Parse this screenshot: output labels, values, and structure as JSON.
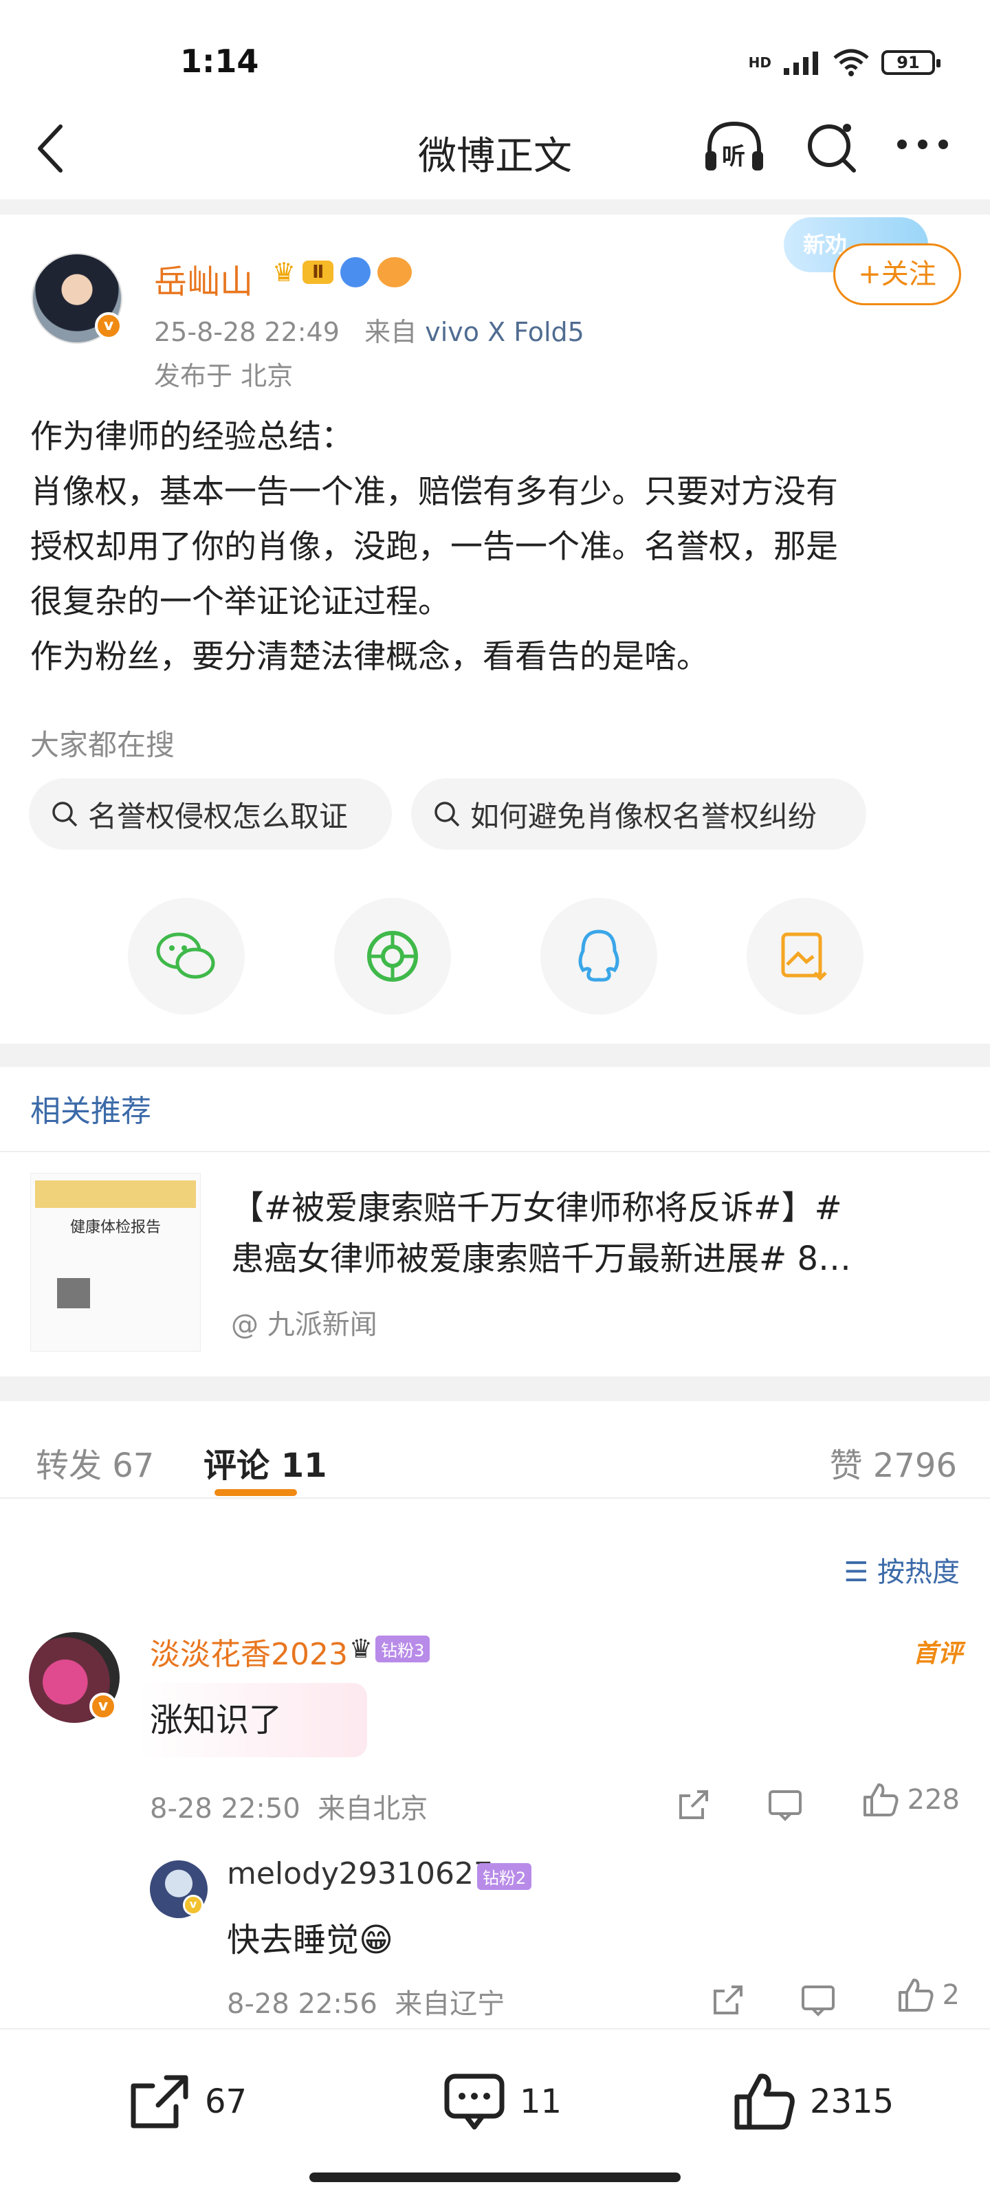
{
  "status_bar": {
    "time": "1:14",
    "battery": "91",
    "network": "HD"
  },
  "nav": {
    "title": "微博正文",
    "listen_label": "听"
  },
  "post": {
    "author": "岳屾山",
    "timestamp": "25-8-28 22:49",
    "source_prefix": "来自",
    "source": "vivo X Fold5",
    "location": "发布于 北京",
    "follow_label": "+关注",
    "promo_label": "新劝",
    "level_badge": "Ⅱ",
    "body_lines": [
      "作为律师的经验总结：",
      "肖像权，基本一告一个准，赔偿有多有少。只要对方没有",
      "授权却用了你的肖像，没跑，一告一个准。名誉权，那是",
      "很复杂的一个举证论证过程。",
      "作为粉丝，要分清楚法律概念，看看告的是啥。"
    ]
  },
  "search": {
    "label": "大家都在搜",
    "chips": [
      "名誉权侵权怎么取证",
      "如何避免肖像权名誉权纠纷"
    ]
  },
  "share_icons": [
    "wechat-icon",
    "moments-icon",
    "qq-icon",
    "save-image-icon"
  ],
  "related": {
    "heading": "相关推荐",
    "title_line1": "【#被爱康索赔千万女律师称将反诉#】#",
    "title_line2": "患癌女律师被爱康索赔千万最新进展# 8…",
    "source": "@ 九派新闻",
    "thumb_text": "健康体检报告"
  },
  "tabs": {
    "repost": "转发 67",
    "comments": "评论 11",
    "likes": "赞 2796"
  },
  "sort_label": "按热度",
  "comments": [
    {
      "name": "淡淡花香2023",
      "fan_badge": "钻粉3",
      "tag": "首评",
      "text": "涨知识了",
      "time": "8-28 22:50",
      "from": "来自北京",
      "likes": "228"
    },
    {
      "name": "melody29310627",
      "fan_badge": "钻粉2",
      "text": "快去睡觉😁",
      "time": "8-28 22:56",
      "from": "来自辽宁",
      "likes": "2"
    }
  ],
  "bottom_bar": {
    "repost": "67",
    "comment": "11",
    "like": "2315"
  },
  "colors": {
    "accent": "#f08a13",
    "link": "#3b6aa8",
    "name": "#e8761f"
  }
}
